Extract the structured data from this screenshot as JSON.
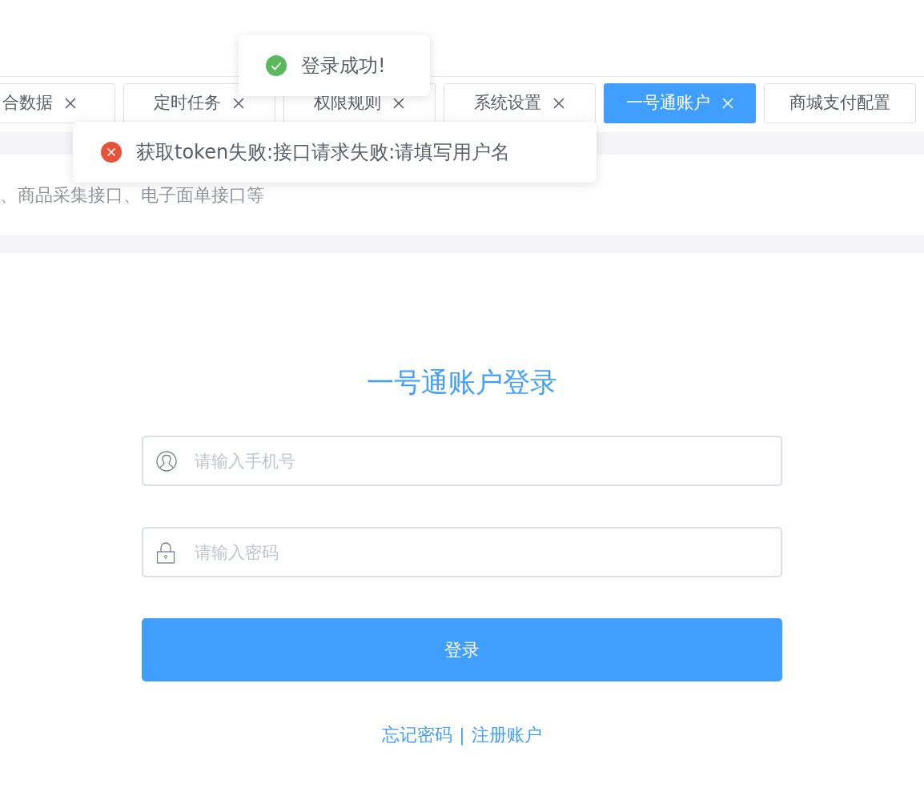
{
  "tabs": [
    {
      "label": "合数据",
      "selected": false,
      "closable": true
    },
    {
      "label": "定时任务",
      "selected": false,
      "closable": true
    },
    {
      "label": "权限规则",
      "selected": false,
      "closable": true
    },
    {
      "label": "系统设置",
      "selected": false,
      "closable": true
    },
    {
      "label": "一号通账户",
      "selected": true,
      "closable": true
    },
    {
      "label": "商城支付配置",
      "selected": false,
      "closable": false
    }
  ],
  "description": "、商品采集接口、电子面单接口等",
  "login": {
    "title": "一号通账户登录",
    "fields": [
      {
        "kind": "phone",
        "placeholder": "请输入手机号"
      },
      {
        "kind": "password",
        "placeholder": "请输入密码"
      }
    ],
    "button": "登录",
    "links": [
      "忘记密码",
      "注册账户"
    ],
    "separator": "|"
  },
  "toasts": [
    {
      "kind": "success",
      "text": "登录成功!"
    },
    {
      "kind": "error",
      "text": "获取token失败:接口请求失败:请填写用户名"
    }
  ]
}
